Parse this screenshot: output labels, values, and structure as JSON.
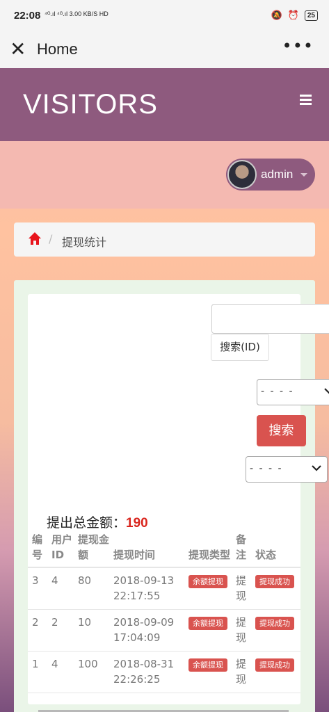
{
  "status_bar": {
    "time": "22:08",
    "signal_text": "⁴ᴳ.ıl ⁴ᴳ.ıl 3.00 KB/S HD",
    "battery": "25"
  },
  "app_bar": {
    "title": "Home"
  },
  "header": {
    "brand": "VISITORS"
  },
  "user": {
    "name": "admin"
  },
  "breadcrumb": {
    "separator": "/",
    "current": "提现统计"
  },
  "filters": {
    "id_search_label": "搜索(ID)",
    "select1_value": "- - - -",
    "search_label": "搜索",
    "select2_value": "- - - -"
  },
  "summary": {
    "label": "提出总金额：",
    "amount": "190"
  },
  "table": {
    "headers": [
      "编号",
      "用户ID",
      "提现金额",
      "提现时间",
      "提现类型",
      "备注",
      "状态"
    ],
    "rows": [
      {
        "id": "3",
        "user_id": "4",
        "amount": "80",
        "time": "2018-09-13 22:17:55",
        "type": "余额提现",
        "note": "提现",
        "status": "提现成功"
      },
      {
        "id": "2",
        "user_id": "2",
        "amount": "10",
        "time": "2018-09-09 17:04:09",
        "type": "余额提现",
        "note": "提现",
        "status": "提现成功"
      },
      {
        "id": "1",
        "user_id": "4",
        "amount": "100",
        "time": "2018-08-31 22:26:25",
        "type": "余额提现",
        "note": "提现",
        "status": "提现成功"
      }
    ]
  },
  "colors": {
    "header": "#8e5a7e",
    "accent_red": "#d9534f",
    "amount_red": "#d9251d",
    "home_icon": "#e8141c"
  },
  "icons": [
    "close-icon",
    "more-icon",
    "menu-icon",
    "home-icon",
    "chevron-down-icon",
    "caret-down-icon"
  ]
}
